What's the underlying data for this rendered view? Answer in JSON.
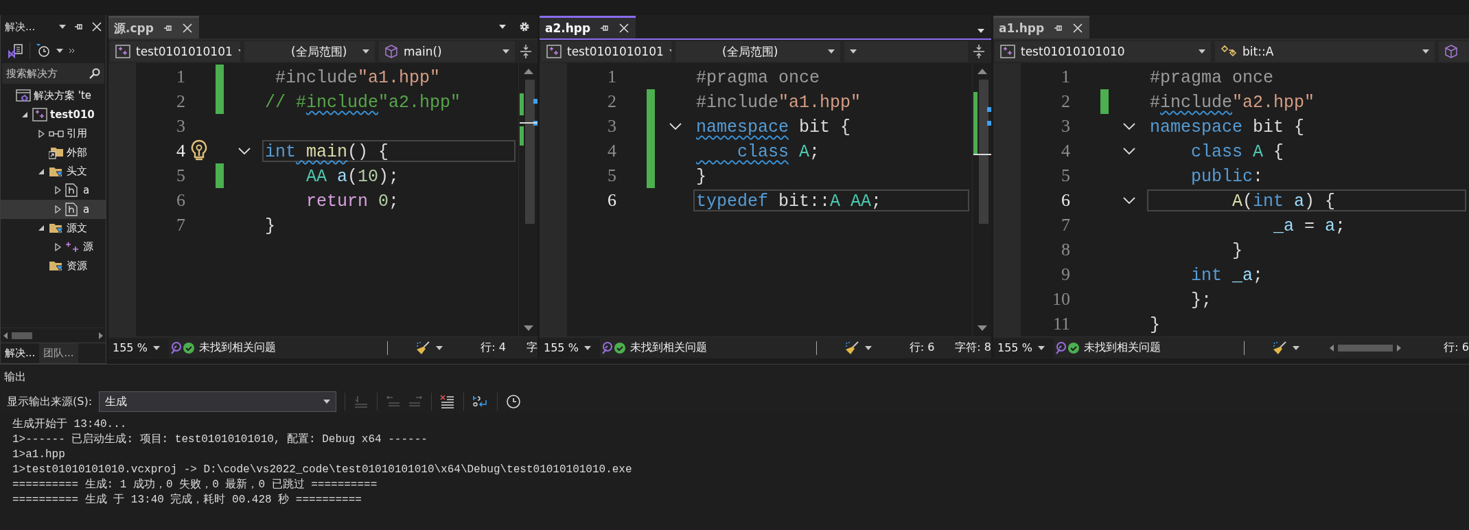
{
  "solution_explorer": {
    "title": "解决...",
    "search": {
      "placeholder": "搜索解决方"
    },
    "tree": [
      {
        "label": "解决方案 'te",
        "kind": "solution",
        "selected": false,
        "children": [
          {
            "label": "test010",
            "kind": "project",
            "expanded": true,
            "selected": false,
            "children": [
              {
                "label": "引用",
                "kind": "references",
                "expanded": false,
                "selected": false
              },
              {
                "label": "外部",
                "kind": "external",
                "selected": false
              },
              {
                "label": "头文",
                "kind": "filter",
                "expanded": true,
                "selected": false,
                "children": [
                  {
                    "label": "a",
                    "kind": "header",
                    "expanded": false,
                    "selected": false
                  },
                  {
                    "label": "a",
                    "kind": "header",
                    "expanded": false,
                    "selected": true
                  }
                ]
              },
              {
                "label": "源文",
                "kind": "filter",
                "expanded": true,
                "selected": false,
                "children": [
                  {
                    "label": "源",
                    "kind": "source",
                    "expanded": false,
                    "selected": false
                  }
                ]
              },
              {
                "label": "资源",
                "kind": "filter",
                "selected": false
              }
            ]
          }
        ]
      }
    ],
    "bottom_tabs": [
      {
        "label": "解决...",
        "selected": true
      },
      {
        "label": "团队...",
        "selected": false
      }
    ]
  },
  "editors": [
    {
      "tab": {
        "title": "源.cpp",
        "active": false
      },
      "nav": {
        "project": "test0101010101",
        "scope": "(全局范围)",
        "member": "main()"
      },
      "lines": [
        {
          "number": "1",
          "changed": true,
          "current": false,
          "lightbulb": false,
          "collapsible": false,
          "tokens": [
            {
              "kind": "pre",
              "text": " #include"
            },
            {
              "kind": "str",
              "text": "\"a1.hpp\""
            }
          ]
        },
        {
          "number": "2",
          "changed": true,
          "current": false,
          "lightbulb": false,
          "collapsible": false,
          "tokens": [
            {
              "kind": "cmt",
              "text": "// #",
              "squiggle": false
            },
            {
              "kind": "cmt",
              "text": "include",
              "squiggle": true
            },
            {
              "kind": "cmt",
              "text": "\"a2.hpp\"",
              "squiggle": false
            }
          ]
        },
        {
          "number": "3",
          "changed": false,
          "current": false,
          "lightbulb": false,
          "collapsible": false
        },
        {
          "number": "4",
          "changed": false,
          "current": true,
          "lightbulb": true,
          "collapsible": true,
          "tokens": [
            {
              "kind": "kw",
              "text": "int",
              "squiggle": false
            },
            {
              "kind": "func",
              "text": " main",
              "squiggle": true
            },
            {
              "kind": "plain",
              "text": "() {",
              "squiggle": false
            }
          ]
        },
        {
          "number": "5",
          "changed": true,
          "current": false,
          "lightbulb": false,
          "collapsible": false,
          "tokens": [
            {
              "kind": "type",
              "text": "    AA"
            },
            {
              "kind": "var",
              "text": " a"
            },
            {
              "kind": "plain",
              "text": "("
            },
            {
              "kind": "num",
              "text": "10"
            },
            {
              "kind": "plain",
              "text": ");"
            }
          ]
        },
        {
          "number": "6",
          "changed": false,
          "current": false,
          "lightbulb": false,
          "collapsible": false,
          "tokens": [
            {
              "kind": "ctl",
              "text": "    return"
            },
            {
              "kind": "num",
              "text": " 0"
            },
            {
              "kind": "plain",
              "text": ";"
            }
          ]
        },
        {
          "number": "7",
          "changed": false,
          "current": false,
          "lightbulb": false,
          "collapsible": false,
          "tokens": [
            {
              "kind": "plain",
              "text": "}"
            }
          ]
        }
      ],
      "status": {
        "zoom": "155 %",
        "issues": "未找到相关问题",
        "line": "行: 4",
        "column": "字"
      }
    },
    {
      "tab": {
        "title": "a2.hpp",
        "active": true
      },
      "nav": {
        "project": "test0101010101",
        "scope": "(全局范围)"
      },
      "lines": [
        {
          "number": "1",
          "changed": false,
          "current": false,
          "lightbulb": false,
          "collapsible": false,
          "tokens": [
            {
              "kind": "pre",
              "text": "#pragma once"
            }
          ]
        },
        {
          "number": "2",
          "changed": true,
          "current": false,
          "lightbulb": false,
          "collapsible": false,
          "tokens": [
            {
              "kind": "pre",
              "text": "#include"
            },
            {
              "kind": "str",
              "text": "\"a1.hpp\""
            }
          ]
        },
        {
          "number": "3",
          "changed": true,
          "current": false,
          "lightbulb": false,
          "collapsible": true,
          "tokens": [
            {
              "kind": "kw",
              "text": "namespace",
              "squiggle": true
            },
            {
              "kind": "plain",
              "text": " bit {",
              "squiggle": false
            }
          ]
        },
        {
          "number": "4",
          "changed": true,
          "current": false,
          "lightbulb": false,
          "collapsible": false,
          "tokens": [
            {
              "kind": "kw",
              "text": "    class",
              "squiggle": true
            },
            {
              "kind": "type",
              "text": " A",
              "squiggle": false
            },
            {
              "kind": "plain",
              "text": ";",
              "squiggle": false
            }
          ]
        },
        {
          "number": "5",
          "changed": true,
          "current": false,
          "lightbulb": false,
          "collapsible": false,
          "tokens": [
            {
              "kind": "plain",
              "text": "}"
            }
          ]
        },
        {
          "number": "6",
          "changed": false,
          "current": true,
          "lightbulb": false,
          "collapsible": false,
          "tokens": [
            {
              "kind": "kw",
              "text": "typedef"
            },
            {
              "kind": "plain",
              "text": " bit::"
            },
            {
              "kind": "type",
              "text": "A"
            },
            {
              "kind": "type",
              "text": " AA"
            },
            {
              "kind": "plain",
              "text": ";"
            }
          ]
        }
      ],
      "status": {
        "zoom": "155 %",
        "issues": "未找到相关问题",
        "line": "行: 6",
        "column": "字符: 8"
      }
    },
    {
      "tab": {
        "title": "a1.hpp",
        "active": false
      },
      "nav": {
        "project": "test01010101010",
        "scope": "bit::A"
      },
      "lines": [
        {
          "number": "1",
          "changed": false,
          "current": false,
          "lightbulb": false,
          "collapsible": false,
          "tokens": [
            {
              "kind": "pre",
              "text": "#pragma once"
            }
          ]
        },
        {
          "number": "2",
          "changed": true,
          "current": false,
          "lightbulb": false,
          "collapsible": false,
          "tokens": [
            {
              "kind": "pre",
              "text": "#",
              "squiggle": false
            },
            {
              "kind": "pre",
              "text": "include",
              "squiggle": true
            },
            {
              "kind": "str",
              "text": "\"a2.hpp\"",
              "squiggle": false
            }
          ]
        },
        {
          "number": "3",
          "changed": false,
          "current": false,
          "lightbulb": false,
          "collapsible": true,
          "tokens": [
            {
              "kind": "kw",
              "text": "namespace"
            },
            {
              "kind": "plain",
              "text": " bit {"
            }
          ]
        },
        {
          "number": "4",
          "changed": false,
          "current": false,
          "lightbulb": false,
          "collapsible": true,
          "tokens": [
            {
              "kind": "kw",
              "text": "    class"
            },
            {
              "kind": "type",
              "text": " A"
            },
            {
              "kind": "plain",
              "text": " {"
            }
          ]
        },
        {
          "number": "5",
          "changed": false,
          "current": false,
          "lightbulb": false,
          "collapsible": false,
          "tokens": [
            {
              "kind": "kw",
              "text": "    public"
            },
            {
              "kind": "plain",
              "text": ":"
            }
          ]
        },
        {
          "number": "6",
          "changed": false,
          "current": true,
          "lightbulb": false,
          "collapsible": true,
          "tokens": [
            {
              "kind": "func",
              "text": "        A"
            },
            {
              "kind": "plain",
              "text": "("
            },
            {
              "kind": "kw",
              "text": "int"
            },
            {
              "kind": "var",
              "text": " a"
            },
            {
              "kind": "plain",
              "text": ") {"
            }
          ]
        },
        {
          "number": "7",
          "changed": false,
          "current": false,
          "lightbulb": false,
          "collapsible": false,
          "tokens": [
            {
              "kind": "var",
              "text": "            _a"
            },
            {
              "kind": "plain",
              "text": " ="
            },
            {
              "kind": "var",
              "text": " a"
            },
            {
              "kind": "plain",
              "text": ";"
            }
          ]
        },
        {
          "number": "8",
          "changed": false,
          "current": false,
          "lightbulb": false,
          "collapsible": false,
          "tokens": [
            {
              "kind": "plain",
              "text": "        }"
            }
          ]
        },
        {
          "number": "9",
          "changed": false,
          "current": false,
          "lightbulb": false,
          "collapsible": false,
          "tokens": [
            {
              "kind": "kw",
              "text": "    int"
            },
            {
              "kind": "var",
              "text": " _a"
            },
            {
              "kind": "plain",
              "text": ";"
            }
          ]
        },
        {
          "number": "10",
          "changed": false,
          "current": false,
          "lightbulb": false,
          "collapsible": false,
          "tokens": [
            {
              "kind": "plain",
              "text": "    };"
            }
          ]
        },
        {
          "number": "11",
          "changed": false,
          "current": false,
          "lightbulb": false,
          "collapsible": false,
          "tokens": [
            {
              "kind": "plain",
              "text": "}"
            }
          ]
        }
      ],
      "status": {
        "zoom": "155 %",
        "issues": "未找到相关问题",
        "line": "行: 6"
      }
    }
  ],
  "output": {
    "title": "输出",
    "source_label": "显示输出来源(S):",
    "source": "生成",
    "lines": [
      "生成开始于 13:40...",
      "1>------ 已启动生成: 项目: test01010101010, 配置: Debug x64 ------",
      "1>a1.hpp",
      "1>test01010101010.vcxproj -> D:\\code\\vs2022_code\\test01010101010\\x64\\Debug\\test01010101010.exe",
      "========== 生成: 1 成功，0 失败，0 最新，0 已跳过 ==========",
      "========== 生成 于 13:40 完成，耗时 00.428 秒 =========="
    ]
  }
}
